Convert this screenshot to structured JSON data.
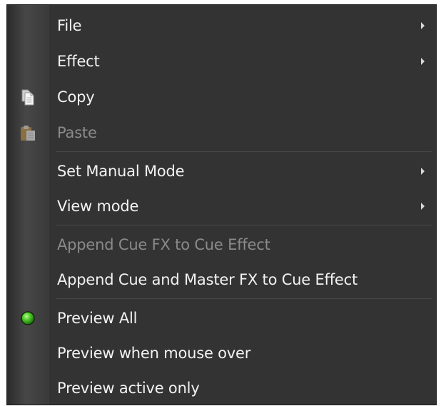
{
  "menu": {
    "items": [
      {
        "label": "File"
      },
      {
        "label": "Effect"
      },
      {
        "label": "Copy"
      },
      {
        "label": "Paste"
      },
      {
        "label": "Set Manual Mode"
      },
      {
        "label": "View mode"
      },
      {
        "label": "Append Cue FX to Cue Effect"
      },
      {
        "label": "Append Cue and Master FX to Cue Effect"
      },
      {
        "label": "Preview All"
      },
      {
        "label": "Preview when mouse over"
      },
      {
        "label": "Preview active only"
      }
    ]
  },
  "icons": {
    "copy": "copy-icon",
    "paste": "paste-icon",
    "selected": "radio-selected-icon"
  },
  "colors": {
    "menu_bg": "#333333",
    "text": "#f2f2f2",
    "disabled_text": "#8a8a8a",
    "indicator_green": "#4ec82a"
  }
}
